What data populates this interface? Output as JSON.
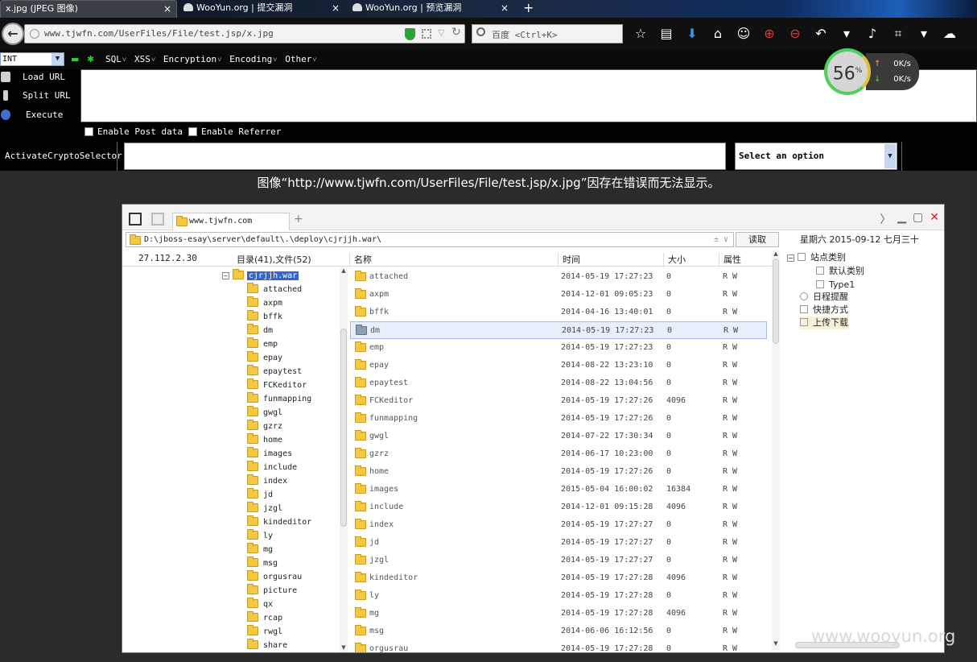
{
  "browser": {
    "tabs": [
      {
        "label": "x.jpg (JPEG 图像)",
        "close": "×"
      },
      {
        "label": "WooYun.org | 提交漏洞",
        "close": "×"
      },
      {
        "label": "WooYun.org | 预览漏洞",
        "close": "×"
      }
    ],
    "new_tab": "+",
    "url": "www.tjwfn.com/UserFiles/File/test.jsp/x.jpg",
    "search_placeholder": "百度 <Ctrl+K>"
  },
  "speed_widget": {
    "percent": "56",
    "percent_unit": "%",
    "up_rate": "0K/s",
    "down_rate": "0K/s"
  },
  "hackbar": {
    "type_select": "INT",
    "menus": [
      "SQL",
      "XSS",
      "Encryption",
      "Encoding",
      "Other"
    ],
    "actions": {
      "load": "Load URL",
      "split": "Split URL",
      "execute": "Execute"
    },
    "enable_post": "Enable Post data",
    "enable_referrer": "Enable Referrer",
    "crypto_label": "ActivateCryptoSelector",
    "select_option": "Select an option"
  },
  "error_message": "图像“http://www.tjwfn.com/UserFiles/File/test.jsp/x.jpg”因存在错误而无法显示。",
  "file_manager": {
    "tab_title": "www.tjwfn.com",
    "path": "D:\\jboss-esay\\server\\default\\.\\deploy\\cjrjjh.war\\",
    "path_options": "± ∨",
    "read_button": "读取",
    "date_display": "星期六 2015-09-12 七月三十",
    "ip": "27.112.2.30",
    "dir_summary": "目录(41),文件(52)",
    "columns": {
      "name": "名称",
      "time": "时间",
      "size": "大小",
      "attr": "属性"
    },
    "tree_root": "cjrjjh.war",
    "tree_items": [
      "attached",
      "axpm",
      "bffk",
      "dm",
      "emp",
      "epay",
      "epaytest",
      "FCKeditor",
      "funmapping",
      "gwgl",
      "gzrz",
      "home",
      "images",
      "include",
      "index",
      "jd",
      "jzgl",
      "kindeditor",
      "ly",
      "mg",
      "msg",
      "orgusrau",
      "picture",
      "qx",
      "rcap",
      "rwgl",
      "share"
    ],
    "files": [
      {
        "name": "attached",
        "time": "2014-05-19 17:27:23",
        "size": "0",
        "attr": "R W"
      },
      {
        "name": "axpm",
        "time": "2014-12-01 09:05:23",
        "size": "0",
        "attr": "R W"
      },
      {
        "name": "bffk",
        "time": "2014-04-16 13:40:01",
        "size": "0",
        "attr": "R W"
      },
      {
        "name": "dm",
        "time": "2014-05-19 17:27:23",
        "size": "0",
        "attr": "R W",
        "selected": true
      },
      {
        "name": "emp",
        "time": "2014-05-19 17:27:23",
        "size": "0",
        "attr": "R W"
      },
      {
        "name": "epay",
        "time": "2014-08-22 13:23:10",
        "size": "0",
        "attr": "R W"
      },
      {
        "name": "epaytest",
        "time": "2014-08-22 13:04:56",
        "size": "0",
        "attr": "R W"
      },
      {
        "name": "FCKeditor",
        "time": "2014-05-19 17:27:26",
        "size": "4096",
        "attr": "R W"
      },
      {
        "name": "funmapping",
        "time": "2014-05-19 17:27:26",
        "size": "0",
        "attr": "R W"
      },
      {
        "name": "gwgl",
        "time": "2014-07-22 17:30:34",
        "size": "0",
        "attr": "R W"
      },
      {
        "name": "gzrz",
        "time": "2014-06-17 10:23:00",
        "size": "0",
        "attr": "R W"
      },
      {
        "name": "home",
        "time": "2014-05-19 17:27:26",
        "size": "0",
        "attr": "R W"
      },
      {
        "name": "images",
        "time": "2015-05-04 16:00:02",
        "size": "16384",
        "attr": "R W"
      },
      {
        "name": "include",
        "time": "2014-12-01 09:15:28",
        "size": "4096",
        "attr": "R W"
      },
      {
        "name": "index",
        "time": "2014-05-19 17:27:27",
        "size": "0",
        "attr": "R W"
      },
      {
        "name": "jd",
        "time": "2014-05-19 17:27:27",
        "size": "0",
        "attr": "R W"
      },
      {
        "name": "jzgl",
        "time": "2014-05-19 17:27:27",
        "size": "0",
        "attr": "R W"
      },
      {
        "name": "kindeditor",
        "time": "2014-05-19 17:27:28",
        "size": "4096",
        "attr": "R W"
      },
      {
        "name": "ly",
        "time": "2014-05-19 17:27:28",
        "size": "0",
        "attr": "R W"
      },
      {
        "name": "mg",
        "time": "2014-05-19 17:27:28",
        "size": "4096",
        "attr": "R W"
      },
      {
        "name": "msg",
        "time": "2014-06-06 16:12:56",
        "size": "0",
        "attr": "R W"
      },
      {
        "name": "orgusrau",
        "time": "2014-05-19 17:27:28",
        "size": "0",
        "attr": "R W"
      }
    ],
    "right_panel": {
      "site_category": "站点类别",
      "default_category": "默认类别",
      "type1": "Type1",
      "schedule": "日程提醒",
      "shortcuts": "快捷方式",
      "upload_download": "上传下载"
    }
  },
  "watermark": "www.wooyun.org"
}
